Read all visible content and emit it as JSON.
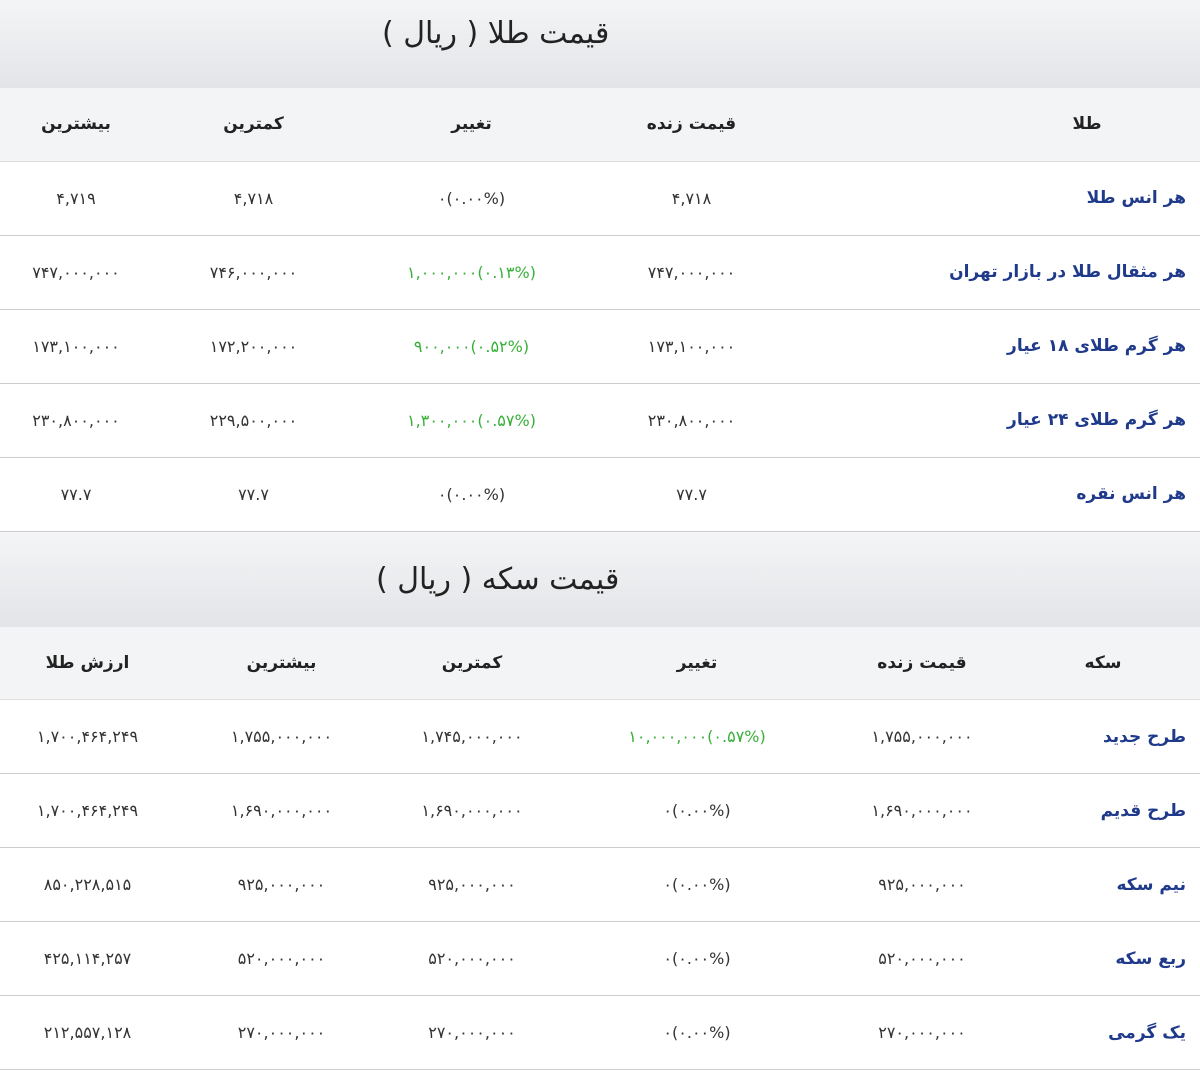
{
  "gold_section": {
    "title": "قیمت طلا ( ریال )",
    "headers": {
      "name": "طلا",
      "live": "قیمت زنده",
      "change": "تغییر",
      "min": "کمترین",
      "max": "بیشترین"
    },
    "rows": [
      {
        "name": "هر انس طلا",
        "live": "۴,۷۱۸",
        "change": "۰(۰.۰۰%)",
        "change_dir": "flat",
        "min": "۴,۷۱۸",
        "max": "۴,۷۱۹"
      },
      {
        "name": "هر مثقال طلا در بازار تهران",
        "live": "۷۴۷,۰۰۰,۰۰۰",
        "change": "۱,۰۰۰,۰۰۰(۰.۱۳%)",
        "change_dir": "up",
        "min": "۷۴۶,۰۰۰,۰۰۰",
        "max": "۷۴۷,۰۰۰,۰۰۰"
      },
      {
        "name": "هر گرم طلای ۱۸ عیار",
        "live": "۱۷۳,۱۰۰,۰۰۰",
        "change": "۹۰۰,۰۰۰(۰.۵۲%)",
        "change_dir": "up",
        "min": "۱۷۲,۲۰۰,۰۰۰",
        "max": "۱۷۳,۱۰۰,۰۰۰"
      },
      {
        "name": "هر گرم طلای ۲۴ عیار",
        "live": "۲۳۰,۸۰۰,۰۰۰",
        "change": "۱,۳۰۰,۰۰۰(۰.۵۷%)",
        "change_dir": "up",
        "min": "۲۲۹,۵۰۰,۰۰۰",
        "max": "۲۳۰,۸۰۰,۰۰۰"
      },
      {
        "name": "هر انس نقره",
        "live": "۷۷.۷",
        "change": "۰(۰.۰۰%)",
        "change_dir": "flat",
        "min": "۷۷.۷",
        "max": "۷۷.۷"
      }
    ]
  },
  "coin_section": {
    "title": "قیمت سکه ( ریال )",
    "headers": {
      "name": "سکه",
      "live": "قیمت زنده",
      "change": "تغییر",
      "min": "کمترین",
      "max": "بیشترین",
      "gold_value": "ارزش طلا"
    },
    "rows": [
      {
        "name": "طرح جدید",
        "live": "۱,۷۵۵,۰۰۰,۰۰۰",
        "change": "۱۰,۰۰۰,۰۰۰(۰.۵۷%)",
        "change_dir": "up",
        "min": "۱,۷۴۵,۰۰۰,۰۰۰",
        "max": "۱,۷۵۵,۰۰۰,۰۰۰",
        "gold_value": "۱,۷۰۰,۴۶۴,۲۴۹"
      },
      {
        "name": "طرح قدیم",
        "live": "۱,۶۹۰,۰۰۰,۰۰۰",
        "change": "۰(۰.۰۰%)",
        "change_dir": "flat",
        "min": "۱,۶۹۰,۰۰۰,۰۰۰",
        "max": "۱,۶۹۰,۰۰۰,۰۰۰",
        "gold_value": "۱,۷۰۰,۴۶۴,۲۴۹"
      },
      {
        "name": "نیم سکه",
        "live": "۹۲۵,۰۰۰,۰۰۰",
        "change": "۰(۰.۰۰%)",
        "change_dir": "flat",
        "min": "۹۲۵,۰۰۰,۰۰۰",
        "max": "۹۲۵,۰۰۰,۰۰۰",
        "gold_value": "۸۵۰,۲۲۸,۵۱۵"
      },
      {
        "name": "ربع سکه",
        "live": "۵۲۰,۰۰۰,۰۰۰",
        "change": "۰(۰.۰۰%)",
        "change_dir": "flat",
        "min": "۵۲۰,۰۰۰,۰۰۰",
        "max": "۵۲۰,۰۰۰,۰۰۰",
        "gold_value": "۴۲۵,۱۱۴,۲۵۷"
      },
      {
        "name": "یک گرمی",
        "live": "۲۷۰,۰۰۰,۰۰۰",
        "change": "۰(۰.۰۰%)",
        "change_dir": "flat",
        "min": "۲۷۰,۰۰۰,۰۰۰",
        "max": "۲۷۰,۰۰۰,۰۰۰",
        "gold_value": "۲۱۲,۵۵۷,۱۲۸"
      }
    ]
  },
  "colors": {
    "positive_change": "#38b038",
    "item_name": "#1f3a8a"
  }
}
